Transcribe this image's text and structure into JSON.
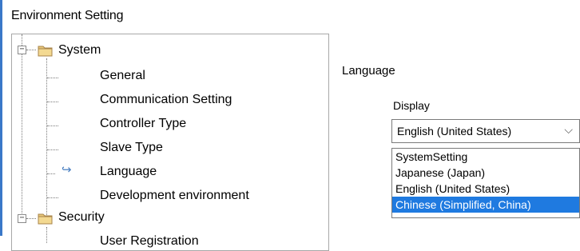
{
  "window": {
    "title": "Environment Setting"
  },
  "tree": {
    "system": {
      "label": "System",
      "expander": "−",
      "children": [
        {
          "label": "General"
        },
        {
          "label": "Communication Setting"
        },
        {
          "label": "Controller Type"
        },
        {
          "label": "Slave Type"
        },
        {
          "label": "Language",
          "selected": true
        },
        {
          "label": "Development environment"
        }
      ]
    },
    "security": {
      "label": "Security",
      "expander": "−",
      "children": [
        {
          "label": "User Registration"
        }
      ]
    }
  },
  "language_panel": {
    "heading": "Language",
    "display_label": "Display",
    "selected_value": "English (United States)",
    "options": [
      "SystemSetting",
      "Japanese (Japan)",
      "English (United States)",
      "Chinese (Simplified, China)"
    ],
    "highlighted_option_index": 3
  },
  "colors": {
    "accent": "#1f7ae0",
    "folder": "#e8c77a",
    "tree_border": "#a8a8a8"
  },
  "icons": {
    "folder": "folder-icon",
    "expander": "collapse-icon",
    "arrow": "arrow-right-icon",
    "chevron": "chevron-down-icon"
  }
}
